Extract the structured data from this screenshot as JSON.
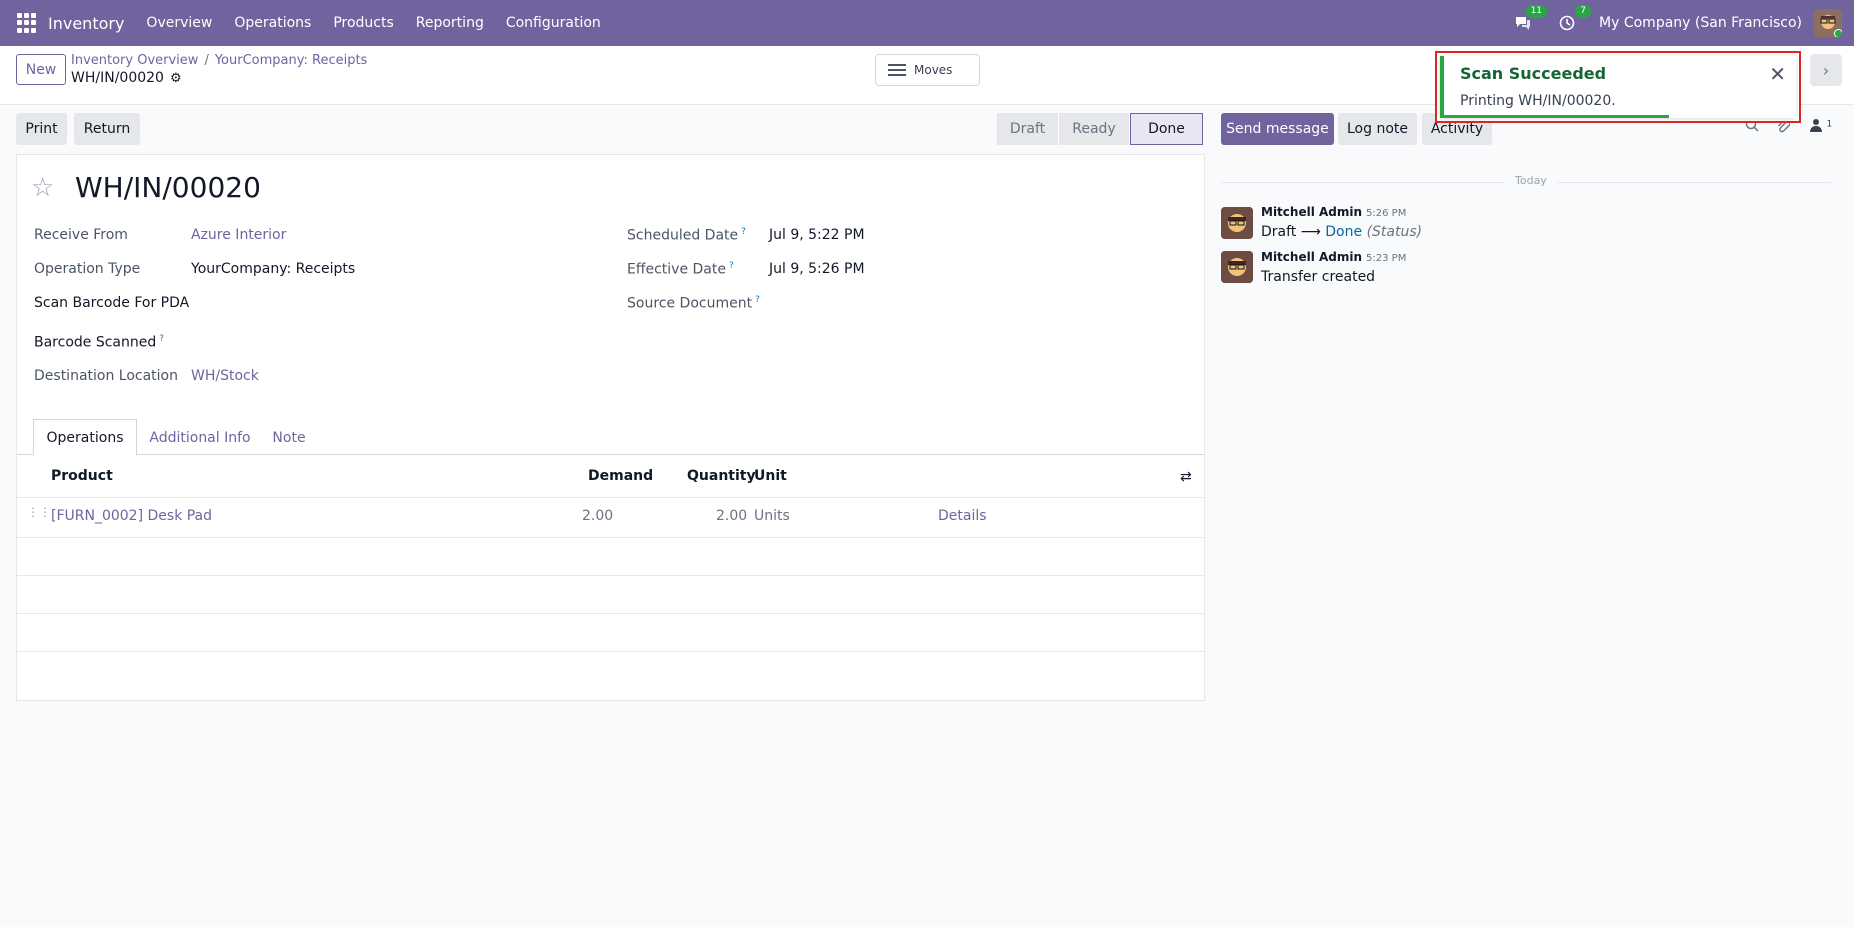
{
  "navbar": {
    "app_name": "Inventory",
    "menu": [
      "Overview",
      "Operations",
      "Products",
      "Reporting",
      "Configuration"
    ],
    "messages_count": "11",
    "activities_count": "7",
    "company": "My Company (San Francisco)"
  },
  "control": {
    "new_label": "New",
    "breadcrumb": [
      "Inventory Overview",
      "YourCompany: Receipts"
    ],
    "record": "WH/IN/00020",
    "moves_label": "Moves"
  },
  "actions": {
    "print": "Print",
    "return": "Return",
    "stages": [
      "Draft",
      "Ready",
      "Done"
    ],
    "active_stage": "Done"
  },
  "form": {
    "title": "WH/IN/00020",
    "fields": {
      "receive_from_label": "Receive From",
      "receive_from": "Azure Interior",
      "operation_type_label": "Operation Type",
      "operation_type": "YourCompany: Receipts",
      "scan_barcode_label": "Scan Barcode For PDA",
      "barcode_scanned_label": "Barcode Scanned",
      "destination_label": "Destination Location",
      "destination": "WH/Stock",
      "scheduled_label": "Scheduled Date",
      "scheduled": "Jul 9, 5:22 PM",
      "effective_label": "Effective Date",
      "effective": "Jul 9, 5:26 PM",
      "source_doc_label": "Source Document",
      "help_mark": "?"
    },
    "tabs": [
      "Operations",
      "Additional Info",
      "Note"
    ],
    "table": {
      "headers": [
        "Product",
        "Demand",
        "Quantity",
        "Unit"
      ],
      "rows": [
        {
          "product": "[FURN_0002] Desk Pad",
          "demand": "2.00",
          "quantity": "2.00",
          "unit": "Units",
          "details": "Details"
        }
      ]
    }
  },
  "chatter": {
    "send_message": "Send message",
    "log_note": "Log note",
    "activity": "Activity",
    "followers_count": "1",
    "today": "Today",
    "messages": [
      {
        "author": "Mitchell Admin",
        "time": "5:26 PM",
        "from": "Draft",
        "arrow": "⟶",
        "to": "Done",
        "field": "(Status)"
      },
      {
        "author": "Mitchell Admin",
        "time": "5:23 PM",
        "body": "Transfer created"
      }
    ]
  },
  "toast": {
    "title": "Scan Succeeded",
    "body": "Printing WH/IN/00020."
  },
  "colors": {
    "brand": "#71639e",
    "success": "#28a745",
    "highlight": "#dc2626"
  }
}
